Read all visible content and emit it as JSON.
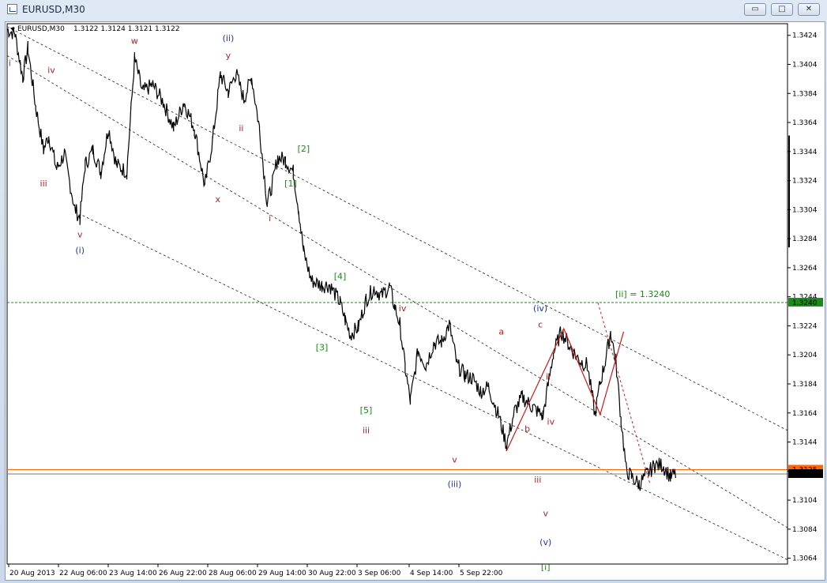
{
  "window": {
    "title": "EURUSD,M30",
    "buttons": {
      "minimize": "▭",
      "maximize": "□",
      "close": "✕"
    }
  },
  "chart_header": {
    "symbol": "EURUSD,M30",
    "ohlc": "1.3122 1.3124 1.3121 1.3122"
  },
  "chart_data": {
    "type": "candlestick",
    "symbol": "EURUSD",
    "timeframe": "M30",
    "x_labels": [
      "20 Aug 2013",
      "22 Aug 06:00",
      "23 Aug 14:00",
      "26 Aug 22:00",
      "28 Aug 06:00",
      "29 Aug 14:00",
      "30 Aug 22:00",
      "3 Sep 06:00",
      "4 Sep 14:00",
      "5 Sep 22:00"
    ],
    "y_ticks": [
      "1.3424",
      "1.3404",
      "1.3384",
      "1.3364",
      "1.3344",
      "1.3324",
      "1.3304",
      "1.3284",
      "1.3264",
      "1.3244",
      "1.3224",
      "1.3204",
      "1.3184",
      "1.3164",
      "1.3144",
      "1.3124",
      "1.3104",
      "1.3084",
      "1.3064"
    ],
    "ylim": [
      1.306,
      1.3432
    ],
    "price_path": [
      [
        0,
        1.3428
      ],
      [
        3,
        1.3425
      ],
      [
        6,
        1.3395
      ],
      [
        8,
        1.3415
      ],
      [
        11,
        1.3375
      ],
      [
        14,
        1.3345
      ],
      [
        16,
        1.3355
      ],
      [
        19,
        1.3332
      ],
      [
        22,
        1.3342
      ],
      [
        26,
        1.3305
      ],
      [
        28,
        1.3298
      ],
      [
        30,
        1.3335
      ],
      [
        33,
        1.3345
      ],
      [
        36,
        1.333
      ],
      [
        39,
        1.336
      ],
      [
        42,
        1.3335
      ],
      [
        46,
        1.333
      ],
      [
        49,
        1.3408
      ],
      [
        52,
        1.3385
      ],
      [
        56,
        1.339
      ],
      [
        60,
        1.3378
      ],
      [
        64,
        1.336
      ],
      [
        68,
        1.3378
      ],
      [
        72,
        1.336
      ],
      [
        76,
        1.332
      ],
      [
        79,
        1.3352
      ],
      [
        82,
        1.3397
      ],
      [
        85,
        1.3385
      ],
      [
        88,
        1.3398
      ],
      [
        91,
        1.338
      ],
      [
        94,
        1.3395
      ],
      [
        97,
        1.336
      ],
      [
        100,
        1.3308
      ],
      [
        102,
        1.3322
      ],
      [
        104,
        1.334
      ],
      [
        107,
        1.3338
      ],
      [
        110,
        1.333
      ],
      [
        112,
        1.3305
      ],
      [
        114,
        1.3275
      ],
      [
        117,
        1.3255
      ],
      [
        121,
        1.3252
      ],
      [
        124,
        1.3252
      ],
      [
        128,
        1.324
      ],
      [
        130,
        1.3228
      ],
      [
        132,
        1.3218
      ],
      [
        135,
        1.3223
      ],
      [
        138,
        1.3242
      ],
      [
        141,
        1.325
      ],
      [
        144,
        1.3245
      ],
      [
        147,
        1.3251
      ],
      [
        149,
        1.3237
      ],
      [
        151,
        1.3225
      ],
      [
        153,
        1.3195
      ],
      [
        155,
        1.3172
      ],
      [
        158,
        1.3207
      ],
      [
        161,
        1.3197
      ],
      [
        164,
        1.3212
      ],
      [
        167,
        1.3213
      ],
      [
        170,
        1.3225
      ],
      [
        173,
        1.3197
      ],
      [
        176,
        1.319
      ],
      [
        179,
        1.3188
      ],
      [
        182,
        1.3179
      ],
      [
        185,
        1.3182
      ],
      [
        189,
        1.3162
      ],
      [
        192,
        1.3142
      ],
      [
        195,
        1.3165
      ],
      [
        198,
        1.3175
      ],
      [
        202,
        1.3168
      ],
      [
        206,
        1.3162
      ],
      [
        210,
        1.3205
      ],
      [
        213,
        1.322
      ],
      [
        217,
        1.3208
      ],
      [
        220,
        1.32
      ],
      [
        223,
        1.3197
      ],
      [
        226,
        1.3163
      ],
      [
        228,
        1.3185
      ],
      [
        230,
        1.32
      ],
      [
        232,
        1.322
      ],
      [
        234,
        1.32
      ],
      [
        236,
        1.316
      ],
      [
        238,
        1.3125
      ],
      [
        240,
        1.312
      ],
      [
        243,
        1.3115
      ],
      [
        246,
        1.3122
      ],
      [
        249,
        1.3128
      ],
      [
        252,
        1.3128
      ],
      [
        255,
        1.312
      ],
      [
        257,
        1.3122
      ]
    ],
    "x_range": [
      0,
      300
    ],
    "levels": [
      {
        "label": "[ii] = 1.3240",
        "value": 1.324,
        "color": "#1a8a1a",
        "style": "dashed",
        "tag": "1.3240"
      },
      {
        "label": "",
        "value": 1.3125,
        "color": "#ff6600",
        "style": "solid",
        "tag": "1.3125"
      },
      {
        "label": "",
        "value": 1.3122,
        "color": "#7a7a7a",
        "style": "solid",
        "tag": "1.3122"
      }
    ],
    "channels": [
      {
        "from": [
          0,
          1.341
        ],
        "to": [
          300,
          1.3085
        ]
      },
      {
        "from": [
          0,
          1.343
        ],
        "to": [
          300,
          1.3152
        ]
      },
      {
        "from": [
          29,
          1.33
        ],
        "to": [
          300,
          1.3063
        ]
      }
    ],
    "projection": [
      [
        247,
        1.3116
      ],
      [
        300,
        1.324
      ]
    ],
    "zigzag": [
      [
        192,
        1.3138
      ],
      [
        214,
        1.3222
      ],
      [
        228,
        1.3163
      ],
      [
        237,
        1.322
      ]
    ],
    "wave_labels": [
      {
        "text": "i",
        "x": 1,
        "y": 1.3403,
        "color": "#b22222"
      },
      {
        "text": "iv",
        "x": 17,
        "y": 1.3398,
        "color": "#b22222"
      },
      {
        "text": "iii",
        "x": 14,
        "y": 1.332,
        "color": "#b22222"
      },
      {
        "text": "v",
        "x": 28,
        "y": 1.3285,
        "color": "#b22222"
      },
      {
        "text": "(i)",
        "x": 28,
        "y": 1.3274,
        "color": "#2233aa"
      },
      {
        "text": "w",
        "x": 49,
        "y": 1.3418,
        "color": "#b22222"
      },
      {
        "text": "(ii)",
        "x": 85,
        "y": 1.342,
        "color": "#2233aa"
      },
      {
        "text": "y",
        "x": 85,
        "y": 1.3408,
        "color": "#b22222"
      },
      {
        "text": "x",
        "x": 81,
        "y": 1.3309,
        "color": "#b22222"
      },
      {
        "text": "ii",
        "x": 90,
        "y": 1.3358,
        "color": "#b22222"
      },
      {
        "text": "i",
        "x": 101,
        "y": 1.3296,
        "color": "#b22222"
      },
      {
        "text": "[2]",
        "x": 114,
        "y": 1.3344,
        "color": "#1a8a1a"
      },
      {
        "text": "[1]",
        "x": 109,
        "y": 1.332,
        "color": "#1a8a1a"
      },
      {
        "text": "[4]",
        "x": 128,
        "y": 1.3256,
        "color": "#1a8a1a"
      },
      {
        "text": "[3]",
        "x": 121,
        "y": 1.3207,
        "color": "#1a8a1a"
      },
      {
        "text": "iv",
        "x": 152,
        "y": 1.3234,
        "color": "#b22222"
      },
      {
        "text": "[5]",
        "x": 138,
        "y": 1.3164,
        "color": "#1a8a1a"
      },
      {
        "text": "iii",
        "x": 138,
        "y": 1.315,
        "color": "#b22222"
      },
      {
        "text": "v",
        "x": 172,
        "y": 1.313,
        "color": "#b22222"
      },
      {
        "text": "(iii)",
        "x": 172,
        "y": 1.3113,
        "color": "#2233aa"
      },
      {
        "text": "a",
        "x": 190,
        "y": 1.3218,
        "color": "#b22222"
      },
      {
        "text": "(iv)",
        "x": 205,
        "y": 1.3234,
        "color": "#2233aa"
      },
      {
        "text": "c",
        "x": 205,
        "y": 1.3223,
        "color": "#b22222"
      },
      {
        "text": "ii",
        "x": 208,
        "y": 1.3187,
        "color": "#b22222"
      },
      {
        "text": "b",
        "x": 200,
        "y": 1.3151,
        "color": "#b22222"
      },
      {
        "text": "iv",
        "x": 209,
        "y": 1.3156,
        "color": "#b22222"
      },
      {
        "text": "iii",
        "x": 204,
        "y": 1.3116,
        "color": "#b22222"
      },
      {
        "text": "v",
        "x": 207,
        "y": 1.3093,
        "color": "#b22222"
      },
      {
        "text": "(v)",
        "x": 207,
        "y": 1.3073,
        "color": "#2233aa"
      },
      {
        "text": "[i]",
        "x": 207,
        "y": 1.3056,
        "color": "#1a8a1a"
      }
    ]
  }
}
